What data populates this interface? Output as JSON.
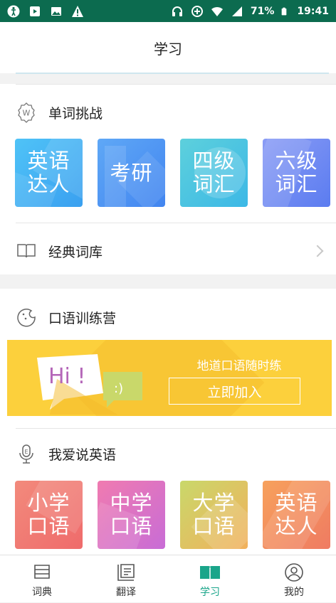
{
  "status_bar": {
    "battery": "71%",
    "time": "19:41"
  },
  "header": {
    "title": "学习"
  },
  "word_challenge": {
    "title": "单词挑战",
    "tiles": [
      {
        "label": "英语\n达人"
      },
      {
        "label": "考研"
      },
      {
        "label": "四级\n词汇"
      },
      {
        "label": "六级\n词汇"
      }
    ]
  },
  "classic_lexicon": {
    "title": "经典词库"
  },
  "oral_camp": {
    "title": "口语训练营",
    "banner": {
      "bubble_text": "Hi !",
      "emoticon": ":)",
      "slogan": "地道口语随时练",
      "join_label": "立即加入"
    }
  },
  "love_english": {
    "title": "我爱说英语",
    "tiles": [
      {
        "label": "小学\n口语"
      },
      {
        "label": "中学\n口语"
      },
      {
        "label": "大学\n口语"
      },
      {
        "label": "英语\n达人"
      }
    ]
  },
  "tabbar": {
    "items": [
      {
        "label": "词典"
      },
      {
        "label": "翻译"
      },
      {
        "label": "学习"
      },
      {
        "label": "我的"
      }
    ],
    "active_color": "#1aa58a"
  }
}
